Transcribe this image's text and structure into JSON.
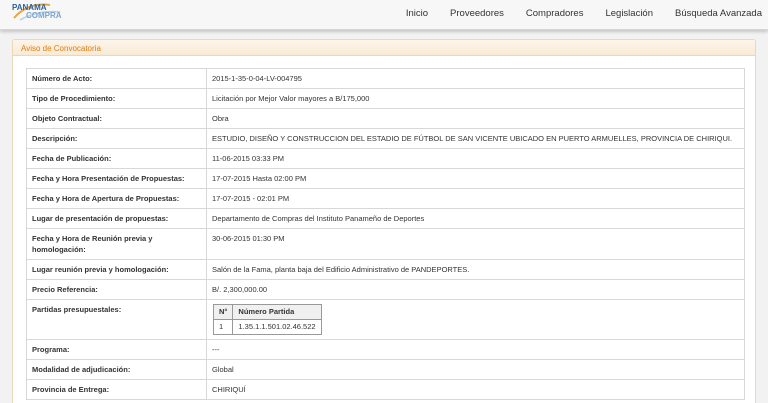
{
  "header": {
    "logo_text": "PANAMA COMPRA",
    "nav": [
      "Inicio",
      "Proveedores",
      "Compradores",
      "Legislación",
      "Búsqueda Avanzada"
    ]
  },
  "panel": {
    "title": "Aviso de Convocatoria"
  },
  "fields": [
    {
      "label": "Número de Acto:",
      "value": "2015-1-35-0-04-LV-004795"
    },
    {
      "label": "Tipo de Procedimiento:",
      "value": "Licitación por Mejor Valor mayores a B/175,000"
    },
    {
      "label": "Objeto Contractual:",
      "value": "Obra"
    },
    {
      "label": "Descripción:",
      "value": "ESTUDIO, DISEÑO Y CONSTRUCCION DEL ESTADIO DE FÚTBOL DE SAN VICENTE UBICADO EN PUERTO ARMUELLES, PROVINCIA DE CHIRIQUI."
    },
    {
      "label": "Fecha de Publicación:",
      "value": "11-06-2015 03:33 PM"
    },
    {
      "label": "Fecha y Hora Presentación de Propuestas:",
      "value": "17-07-2015 Hasta 02:00 PM"
    },
    {
      "label": "Fecha y Hora de Apertura de Propuestas:",
      "value": "17-07-2015 - 02:01 PM"
    },
    {
      "label": "Lugar de presentación de propuestas:",
      "value": "Departamento de Compras del Instituto Panameño de Deportes"
    },
    {
      "label": "Fecha y Hora de Reunión previa y homologación:",
      "value": "30-06-2015 01:30 PM"
    },
    {
      "label": "Lugar reunión previa y homologación:",
      "value": "Salón de la Fama, planta baja del Edificio Administrativo de PANDEPORTES."
    },
    {
      "label": "Precio Referencia:",
      "value": "B/. 2,300,000.00"
    },
    {
      "label": "Partidas presupuestales:",
      "value": ""
    },
    {
      "label": "Programa:",
      "value": "---"
    },
    {
      "label": "Modalidad de adjudicación:",
      "value": "Global"
    },
    {
      "label": "Provincia de Entrega:",
      "value": "CHIRIQUÍ"
    }
  ],
  "partidas": {
    "headers": [
      "N°",
      "Número Partida"
    ],
    "rows": [
      [
        "1",
        "1.35.1.1.501.02.46.522"
      ]
    ]
  }
}
